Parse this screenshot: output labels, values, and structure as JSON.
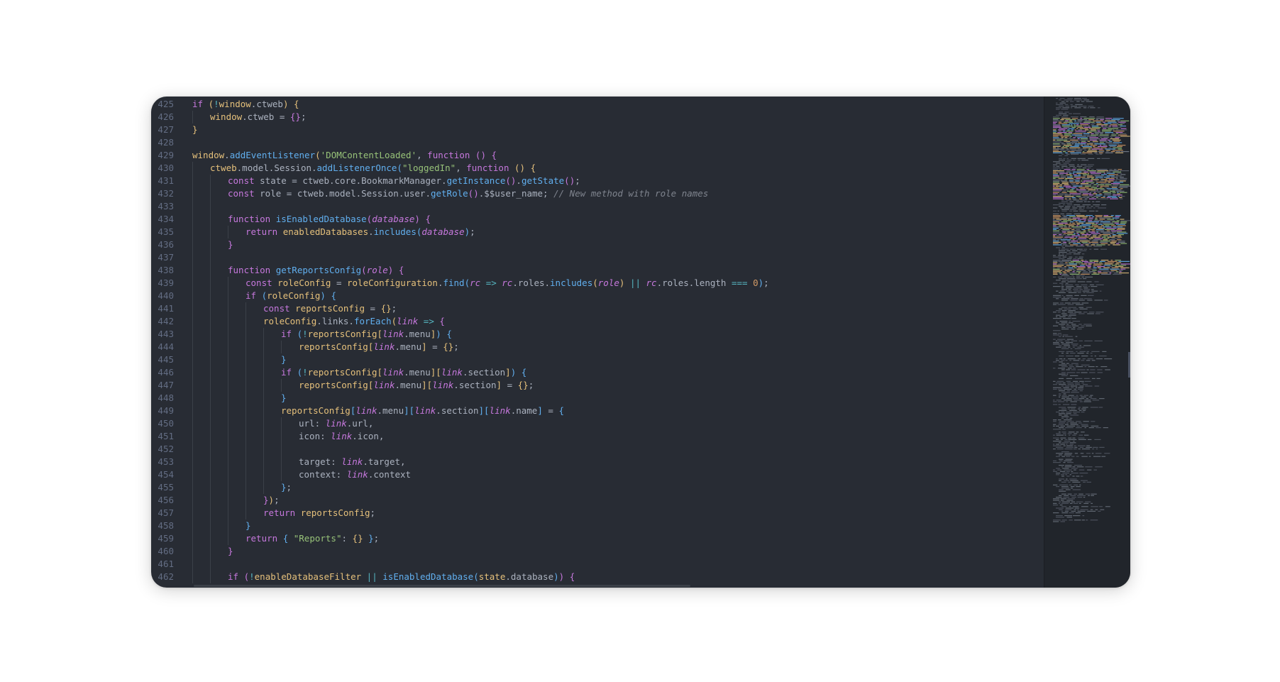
{
  "editor": {
    "lines": [
      {
        "n": "425",
        "indent": 0,
        "tokens": [
          [
            "kw",
            "if "
          ],
          [
            "b1",
            "("
          ],
          [
            "op",
            "!"
          ],
          [
            "vr",
            "window"
          ],
          [
            "pr",
            ".ctweb"
          ],
          [
            "b1",
            ")"
          ],
          [
            "pr",
            " "
          ],
          [
            "b1",
            "{"
          ]
        ]
      },
      {
        "n": "426",
        "indent": 1,
        "tokens": [
          [
            "vr",
            "window"
          ],
          [
            "pr",
            ".ctweb = "
          ],
          [
            "b2",
            "{}"
          ],
          [
            "pr",
            ";"
          ]
        ]
      },
      {
        "n": "427",
        "indent": 0,
        "tokens": [
          [
            "b1",
            "}"
          ]
        ]
      },
      {
        "n": "428",
        "indent": 0,
        "tokens": []
      },
      {
        "n": "429",
        "indent": 0,
        "tokens": [
          [
            "vr",
            "window"
          ],
          [
            "pr",
            "."
          ],
          [
            "fn",
            "addEventListener"
          ],
          [
            "b1",
            "("
          ],
          [
            "str",
            "'DOMContentLoaded'"
          ],
          [
            "pr",
            ", "
          ],
          [
            "kw",
            "function"
          ],
          [
            "pr",
            " "
          ],
          [
            "b2",
            "()"
          ],
          [
            "pr",
            " "
          ],
          [
            "b2",
            "{"
          ]
        ]
      },
      {
        "n": "430",
        "indent": 1,
        "tokens": [
          [
            "vr",
            "ctweb"
          ],
          [
            "pr",
            ".model.Session."
          ],
          [
            "fn",
            "addListenerOnce"
          ],
          [
            "b3",
            "("
          ],
          [
            "str",
            "\"loggedIn\""
          ],
          [
            "pr",
            ", "
          ],
          [
            "kw",
            "function"
          ],
          [
            "pr",
            " "
          ],
          [
            "b1",
            "()"
          ],
          [
            "pr",
            " "
          ],
          [
            "b1",
            "{"
          ]
        ]
      },
      {
        "n": "431",
        "indent": 2,
        "tokens": [
          [
            "kw",
            "const "
          ],
          [
            "pr",
            "state = ctweb.core.BookmarkManager."
          ],
          [
            "fn",
            "getInstance"
          ],
          [
            "b2",
            "()"
          ],
          [
            "pr",
            "."
          ],
          [
            "fn",
            "getState"
          ],
          [
            "b2",
            "()"
          ],
          [
            "pr",
            ";"
          ]
        ]
      },
      {
        "n": "432",
        "indent": 2,
        "tokens": [
          [
            "kw",
            "const "
          ],
          [
            "pr",
            "role = ctweb.model.Session.user."
          ],
          [
            "fn",
            "getRole"
          ],
          [
            "b2",
            "()"
          ],
          [
            "pr",
            ".$$user_name; "
          ],
          [
            "cm",
            "// New method with role names"
          ]
        ]
      },
      {
        "n": "433",
        "indent": 2,
        "tokens": []
      },
      {
        "n": "434",
        "indent": 2,
        "tokens": [
          [
            "kw",
            "function "
          ],
          [
            "fn",
            "isEnabledDatabase"
          ],
          [
            "b2",
            "("
          ],
          [
            "pm",
            "database"
          ],
          [
            "b2",
            ")"
          ],
          [
            "pr",
            " "
          ],
          [
            "b2",
            "{"
          ]
        ]
      },
      {
        "n": "435",
        "indent": 3,
        "tokens": [
          [
            "kw",
            "return "
          ],
          [
            "vr",
            "enabledDatabases"
          ],
          [
            "pr",
            "."
          ],
          [
            "fn",
            "includes"
          ],
          [
            "b3",
            "("
          ],
          [
            "pm",
            "database"
          ],
          [
            "b3",
            ")"
          ],
          [
            "pr",
            ";"
          ]
        ]
      },
      {
        "n": "436",
        "indent": 2,
        "tokens": [
          [
            "b2",
            "}"
          ]
        ]
      },
      {
        "n": "437",
        "indent": 2,
        "tokens": []
      },
      {
        "n": "438",
        "indent": 2,
        "tokens": [
          [
            "kw",
            "function "
          ],
          [
            "fn",
            "getReportsConfig"
          ],
          [
            "b2",
            "("
          ],
          [
            "pm",
            "role"
          ],
          [
            "b2",
            ")"
          ],
          [
            "pr",
            " "
          ],
          [
            "b2",
            "{"
          ]
        ]
      },
      {
        "n": "439",
        "indent": 3,
        "tokens": [
          [
            "kw",
            "const "
          ],
          [
            "vr",
            "roleConfig"
          ],
          [
            "pr",
            " = "
          ],
          [
            "vr",
            "roleConfiguration"
          ],
          [
            "pr",
            "."
          ],
          [
            "fn",
            "find"
          ],
          [
            "b3",
            "("
          ],
          [
            "pm",
            "rc"
          ],
          [
            "op",
            " => "
          ],
          [
            "pm",
            "rc"
          ],
          [
            "pr",
            ".roles."
          ],
          [
            "fn",
            "includes"
          ],
          [
            "b1",
            "("
          ],
          [
            "pm",
            "role"
          ],
          [
            "b1",
            ")"
          ],
          [
            "op",
            " || "
          ],
          [
            "pm",
            "rc"
          ],
          [
            "pr",
            ".roles.length "
          ],
          [
            "op",
            "==="
          ],
          [
            "pr",
            " "
          ],
          [
            "num",
            "0"
          ],
          [
            "b3",
            ")"
          ],
          [
            "pr",
            ";"
          ]
        ]
      },
      {
        "n": "440",
        "indent": 3,
        "tokens": [
          [
            "kw",
            "if "
          ],
          [
            "b3",
            "("
          ],
          [
            "vr",
            "roleConfig"
          ],
          [
            "b3",
            ")"
          ],
          [
            "pr",
            " "
          ],
          [
            "b3",
            "{"
          ]
        ]
      },
      {
        "n": "441",
        "indent": 4,
        "tokens": [
          [
            "kw",
            "const "
          ],
          [
            "vr",
            "reportsConfig"
          ],
          [
            "pr",
            " = "
          ],
          [
            "b1",
            "{}"
          ],
          [
            "pr",
            ";"
          ]
        ]
      },
      {
        "n": "442",
        "indent": 4,
        "tokens": [
          [
            "vr",
            "roleConfig"
          ],
          [
            "pr",
            ".links."
          ],
          [
            "fn",
            "forEach"
          ],
          [
            "b1",
            "("
          ],
          [
            "pm",
            "link"
          ],
          [
            "op",
            " => "
          ],
          [
            "b2",
            "{"
          ]
        ]
      },
      {
        "n": "443",
        "indent": 5,
        "tokens": [
          [
            "kw",
            "if "
          ],
          [
            "b3",
            "("
          ],
          [
            "op",
            "!"
          ],
          [
            "vr",
            "reportsConfig"
          ],
          [
            "b1",
            "["
          ],
          [
            "pm",
            "link"
          ],
          [
            "pr",
            ".menu"
          ],
          [
            "b1",
            "]"
          ],
          [
            "b3",
            ")"
          ],
          [
            "pr",
            " "
          ],
          [
            "b3",
            "{"
          ]
        ]
      },
      {
        "n": "444",
        "indent": 6,
        "tokens": [
          [
            "vr",
            "reportsConfig"
          ],
          [
            "b1",
            "["
          ],
          [
            "pm",
            "link"
          ],
          [
            "pr",
            ".menu"
          ],
          [
            "b1",
            "]"
          ],
          [
            "pr",
            " = "
          ],
          [
            "b1",
            "{}"
          ],
          [
            "pr",
            ";"
          ]
        ]
      },
      {
        "n": "445",
        "indent": 5,
        "tokens": [
          [
            "b3",
            "}"
          ]
        ]
      },
      {
        "n": "446",
        "indent": 5,
        "tokens": [
          [
            "kw",
            "if "
          ],
          [
            "b3",
            "("
          ],
          [
            "op",
            "!"
          ],
          [
            "vr",
            "reportsConfig"
          ],
          [
            "b1",
            "["
          ],
          [
            "pm",
            "link"
          ],
          [
            "pr",
            ".menu"
          ],
          [
            "b1",
            "]["
          ],
          [
            "pm",
            "link"
          ],
          [
            "pr",
            ".section"
          ],
          [
            "b1",
            "]"
          ],
          [
            "b3",
            ")"
          ],
          [
            "pr",
            " "
          ],
          [
            "b3",
            "{"
          ]
        ]
      },
      {
        "n": "447",
        "indent": 6,
        "tokens": [
          [
            "vr",
            "reportsConfig"
          ],
          [
            "b1",
            "["
          ],
          [
            "pm",
            "link"
          ],
          [
            "pr",
            ".menu"
          ],
          [
            "b1",
            "]["
          ],
          [
            "pm",
            "link"
          ],
          [
            "pr",
            ".section"
          ],
          [
            "b1",
            "]"
          ],
          [
            "pr",
            " = "
          ],
          [
            "b1",
            "{}"
          ],
          [
            "pr",
            ";"
          ]
        ]
      },
      {
        "n": "448",
        "indent": 5,
        "tokens": [
          [
            "b3",
            "}"
          ]
        ]
      },
      {
        "n": "449",
        "indent": 5,
        "tokens": [
          [
            "vr",
            "reportsConfig"
          ],
          [
            "b3",
            "["
          ],
          [
            "pm",
            "link"
          ],
          [
            "pr",
            ".menu"
          ],
          [
            "b3",
            "]["
          ],
          [
            "pm",
            "link"
          ],
          [
            "pr",
            ".section"
          ],
          [
            "b3",
            "]["
          ],
          [
            "pm",
            "link"
          ],
          [
            "pr",
            ".name"
          ],
          [
            "b3",
            "]"
          ],
          [
            "pr",
            " = "
          ],
          [
            "b3",
            "{"
          ]
        ]
      },
      {
        "n": "450",
        "indent": 6,
        "tokens": [
          [
            "pr",
            "url: "
          ],
          [
            "pm",
            "link"
          ],
          [
            "pr",
            ".url,"
          ]
        ]
      },
      {
        "n": "451",
        "indent": 6,
        "tokens": [
          [
            "pr",
            "icon: "
          ],
          [
            "pm",
            "link"
          ],
          [
            "pr",
            ".icon,"
          ]
        ]
      },
      {
        "n": "452",
        "indent": 6,
        "tokens": []
      },
      {
        "n": "453",
        "indent": 6,
        "tokens": [
          [
            "pr",
            "target: "
          ],
          [
            "pm",
            "link"
          ],
          [
            "pr",
            ".target,"
          ]
        ]
      },
      {
        "n": "454",
        "indent": 6,
        "tokens": [
          [
            "pr",
            "context: "
          ],
          [
            "pm",
            "link"
          ],
          [
            "pr",
            ".context"
          ]
        ]
      },
      {
        "n": "455",
        "indent": 5,
        "tokens": [
          [
            "b3",
            "}"
          ],
          [
            "pr",
            ";"
          ]
        ]
      },
      {
        "n": "456",
        "indent": 4,
        "tokens": [
          [
            "b2",
            "}"
          ],
          [
            "b1",
            ")"
          ],
          [
            "pr",
            ";"
          ]
        ]
      },
      {
        "n": "457",
        "indent": 4,
        "tokens": [
          [
            "kw",
            "return "
          ],
          [
            "vr",
            "reportsConfig"
          ],
          [
            "pr",
            ";"
          ]
        ]
      },
      {
        "n": "458",
        "indent": 3,
        "tokens": [
          [
            "b3",
            "}"
          ]
        ]
      },
      {
        "n": "459",
        "indent": 3,
        "tokens": [
          [
            "kw",
            "return "
          ],
          [
            "b3",
            "{"
          ],
          [
            "pr",
            " "
          ],
          [
            "str",
            "\"Reports\""
          ],
          [
            "pr",
            ": "
          ],
          [
            "b1",
            "{}"
          ],
          [
            "pr",
            " "
          ],
          [
            "b3",
            "}"
          ],
          [
            "pr",
            ";"
          ]
        ]
      },
      {
        "n": "460",
        "indent": 2,
        "tokens": [
          [
            "b2",
            "}"
          ]
        ]
      },
      {
        "n": "461",
        "indent": 2,
        "tokens": []
      },
      {
        "n": "462",
        "indent": 2,
        "tokens": [
          [
            "kw",
            "if "
          ],
          [
            "b2",
            "("
          ],
          [
            "op",
            "!"
          ],
          [
            "vr",
            "enableDatabaseFilter"
          ],
          [
            "op",
            " || "
          ],
          [
            "fn",
            "isEnabledDatabase"
          ],
          [
            "b3",
            "("
          ],
          [
            "vr",
            "state"
          ],
          [
            "pr",
            ".database"
          ],
          [
            "b3",
            ")"
          ],
          [
            "b2",
            ")"
          ],
          [
            "pr",
            " "
          ],
          [
            "b2",
            "{"
          ]
        ]
      }
    ]
  },
  "colors": {
    "background": "#282c34",
    "minimap_background": "#21252b",
    "keyword": "#c678dd",
    "function": "#61afef",
    "string": "#98c379",
    "number": "#d19a66",
    "comment": "#7f848e",
    "variable": "#e5c07b"
  }
}
